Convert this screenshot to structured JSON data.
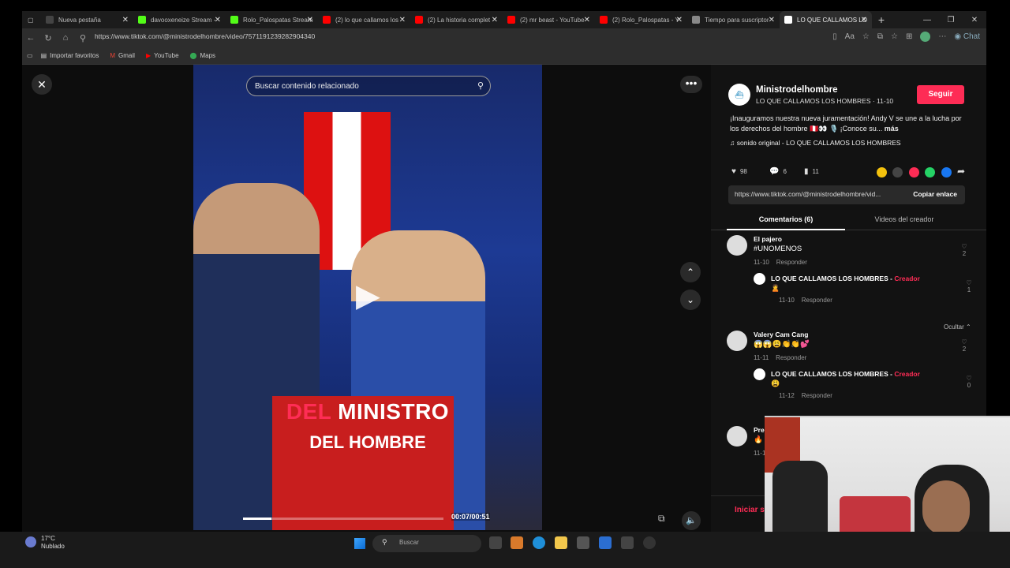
{
  "browser": {
    "tabs": [
      {
        "title": "Nueva pestaña",
        "color": "#444"
      },
      {
        "title": "davooxeneize Stream -",
        "color": "#53fc18"
      },
      {
        "title": "Rolo_Palospatas Stream",
        "color": "#53fc18"
      },
      {
        "title": "(2) lo que callamos los",
        "color": "#ff0000"
      },
      {
        "title": "(2) La historia complet",
        "color": "#ff0000"
      },
      {
        "title": "(2) mr beast - YouTube",
        "color": "#ff0000"
      },
      {
        "title": "(2) Rolo_Palospatas - Y",
        "color": "#ff0000"
      },
      {
        "title": "Tiempo para suscriptor",
        "color": "#888"
      },
      {
        "title": "LO QUE CALLAMOS LO",
        "color": "#ffffff"
      }
    ],
    "url": "https://www.tiktok.com/@ministrodelhombre/video/7571191239282904340",
    "bookmarks": [
      {
        "label": "Importar favoritos",
        "icon": "folder-icon"
      },
      {
        "label": "Gmail",
        "icon": "gmail-icon"
      },
      {
        "label": "YouTube",
        "icon": "youtube-icon"
      },
      {
        "label": "Maps",
        "icon": "maps-icon"
      }
    ],
    "copilot_label": "Chat"
  },
  "video": {
    "search_placeholder": "Buscar contenido relacionado",
    "caption_red": "DEL",
    "caption_line1_rest": " MINISTRO",
    "caption_line2": "DEL HOMBRE",
    "timecode": "00:07/00:51",
    "progress_fraction": 0.14
  },
  "panel": {
    "author_name": "Ministrodelhombre",
    "author_sub": "LO QUE CALLAMOS LOS HOMBRES · 11-10",
    "follow_label": "Seguir",
    "description": "¡Inauguramos nuestra nueva juramentación! Andy V se une a la lucha por los derechos del hombre 🇵🇪👀 🎙️ ¡Conoce su...",
    "more_label": "más",
    "sound": "♫  sonido original - LO QUE CALLAMOS LOS HOMBRES",
    "likes": "98",
    "comments_count": "6",
    "saves": "11",
    "link_text": "https://www.tiktok.com/@ministrodelhombre/vid...",
    "copy_label": "Copiar enlace",
    "tab_comments": "Comentarios (6)",
    "tab_videos": "Videos del creador",
    "hide_label": "Ocultar ⌃",
    "start_label": "Iniciar s",
    "creator_label": "Creador",
    "reply_label": "Responder",
    "comments": [
      {
        "user": "El pajero",
        "text": "#UNOMENOS",
        "date": "11-10",
        "likes": "2",
        "reply": {
          "user": "LO QUE CALLAMOS LOS HOMBRES",
          "text": "🙎",
          "date": "11-10",
          "likes": "1"
        }
      },
      {
        "user": "Valery Cam Cang",
        "text": "😱😱😩👏👏💕",
        "date": "11-11",
        "likes": "2",
        "reply": {
          "user": "LO QUE CALLAMOS LOS HOMBRES",
          "text": "😩",
          "date": "11-12",
          "likes": "0"
        }
      },
      {
        "user": "Pre",
        "text": "🔥",
        "date": "11-1",
        "likes": ""
      }
    ]
  },
  "taskbar": {
    "temp": "17°C",
    "weather": "Nublado",
    "search": "Buscar"
  }
}
